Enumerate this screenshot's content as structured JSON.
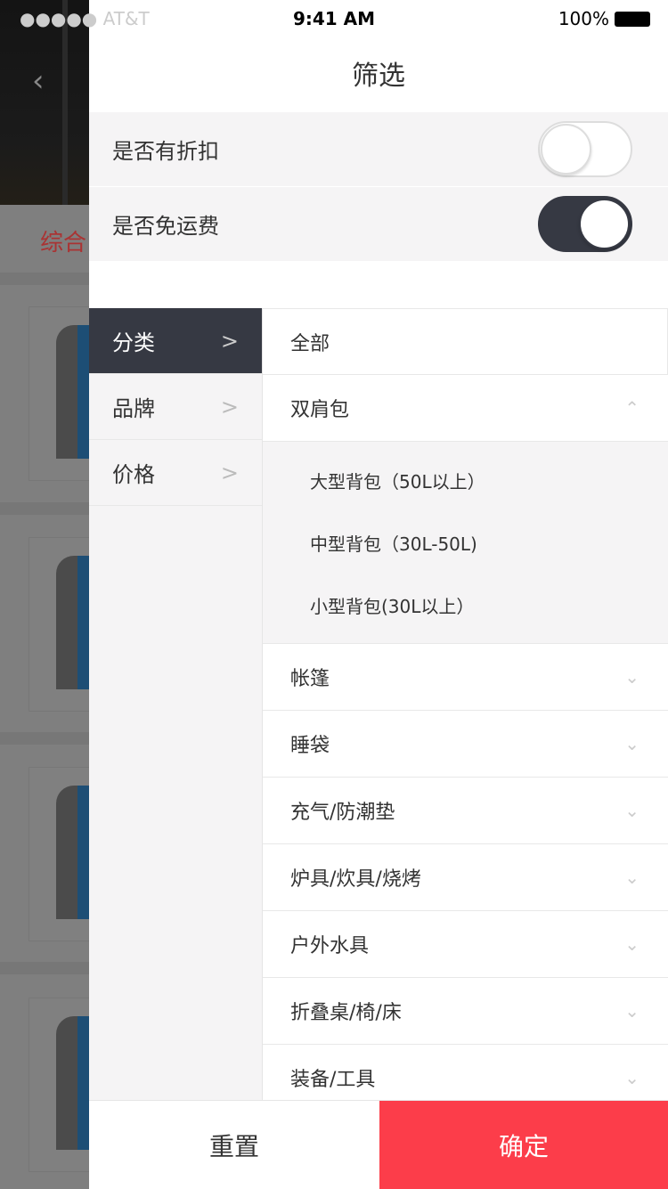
{
  "status": {
    "carrier": "●●●●● AT&T",
    "time": "9:41 AM",
    "battery": "100%"
  },
  "background": {
    "sort_tab": "综合"
  },
  "filter": {
    "title": "筛选",
    "toggles": [
      {
        "label": "是否有折扣",
        "on": false
      },
      {
        "label": "是否免运费",
        "on": true
      }
    ],
    "sidebar": [
      {
        "label": "分类",
        "active": true
      },
      {
        "label": "品牌"
      },
      {
        "label": "价格"
      }
    ],
    "categories": {
      "all": "全部",
      "expanded": {
        "label": "双肩包",
        "children": [
          "大型背包（50L以上）",
          "中型背包（30L-50L)",
          "小型背包(30L以上）"
        ]
      },
      "items": [
        "帐篷",
        "睡袋",
        "充气/防潮垫",
        "炉具/炊具/烧烤",
        "户外水具",
        "折叠桌/椅/床",
        "装备/工具"
      ]
    },
    "reset": "重置",
    "confirm": "确定"
  },
  "colors": {
    "accent": "#fc3d4a",
    "dark": "#363943"
  }
}
